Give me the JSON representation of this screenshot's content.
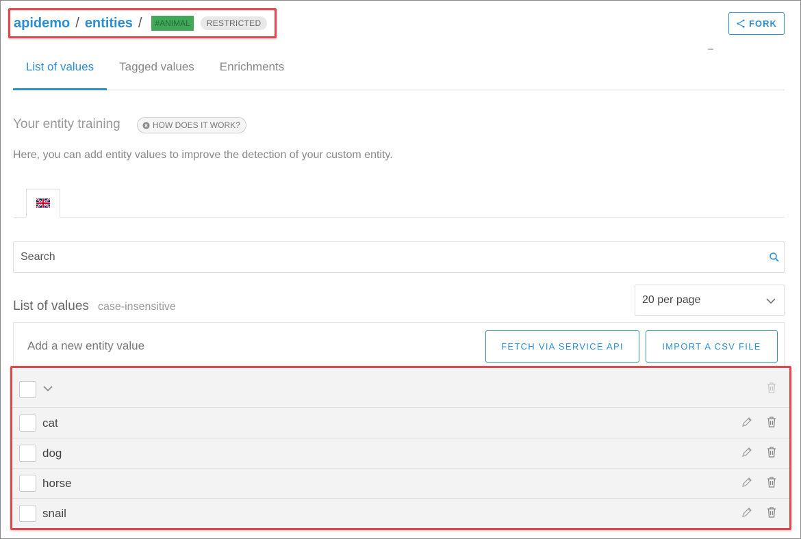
{
  "breadcrumb": {
    "project": "apidemo",
    "separator": "/",
    "section": "entities",
    "entity_tag": "#ANIMAL",
    "visibility_badge": "RESTRICTED"
  },
  "header": {
    "fork_label": "FORK"
  },
  "tabs": [
    {
      "label": "List of values",
      "active": true
    },
    {
      "label": "Tagged values",
      "active": false
    },
    {
      "label": "Enrichments",
      "active": false
    }
  ],
  "training": {
    "title": "Your entity training",
    "help_label": "HOW DOES IT WORK?",
    "description": "Here, you can add entity values to improve the detection of your custom entity."
  },
  "language": {
    "flag_icon": "uk-flag-icon"
  },
  "search": {
    "placeholder": "Search"
  },
  "list": {
    "title": "List of values",
    "subtitle": "case-insensitive",
    "per_page": "20 per page",
    "add_label": "Add a new entity value",
    "fetch_label": "FETCH VIA SERVICE API",
    "import_label": "IMPORT A CSV FILE",
    "values": [
      "cat",
      "dog",
      "horse",
      "snail"
    ]
  },
  "colors": {
    "accent": "#2b8fd6",
    "tag_green": "#41a85a",
    "highlight_red": "#e2474c"
  }
}
